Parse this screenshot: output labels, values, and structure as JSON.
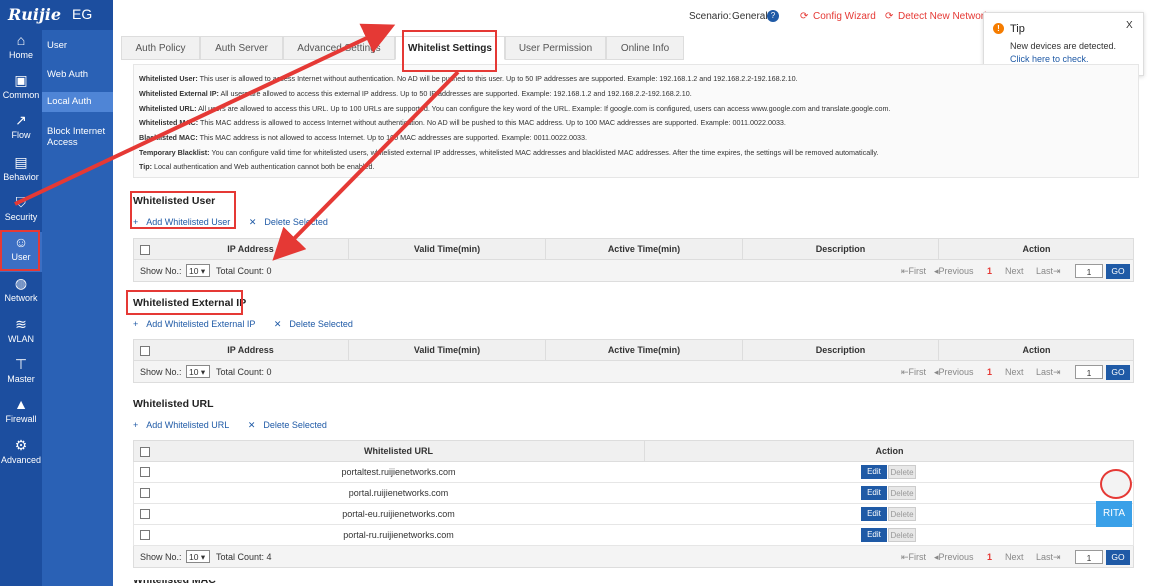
{
  "app": {
    "brand": "Ruijie",
    "product": "EG"
  },
  "nav": [
    {
      "label": "Home",
      "icon": "home-icon"
    },
    {
      "label": "Common",
      "icon": "briefcase-icon"
    },
    {
      "label": "Flow",
      "icon": "chart-line-icon"
    },
    {
      "label": "Behavior",
      "icon": "monitor-icon"
    },
    {
      "label": "Security",
      "icon": "shield-icon"
    },
    {
      "label": "User",
      "icon": "user-icon"
    },
    {
      "label": "Network",
      "icon": "globe-icon"
    },
    {
      "label": "WLAN",
      "icon": "wifi-icon"
    },
    {
      "label": "Master",
      "icon": "hierarchy-icon"
    },
    {
      "label": "Firewall",
      "icon": "firewall-icon"
    },
    {
      "label": "Advanced",
      "icon": "gear-icon"
    }
  ],
  "subnav": [
    "User",
    "Web Auth",
    "Local Auth",
    "Block Internet Access"
  ],
  "header": {
    "scenario_label": "Scenario:",
    "scenario_value": "General",
    "config_wizard": "Config Wizard",
    "detect_network": "Detect New Network"
  },
  "tip": {
    "title": "Tip",
    "message": "New devices are detected.",
    "link": "Click here to check.",
    "close": "X"
  },
  "tabs": [
    "Auth Policy",
    "Auth Server",
    "Advanced Settings",
    "Whitelist Settings",
    "User Permission",
    "Online Info"
  ],
  "info": [
    {
      "k": "Whitelisted User:",
      "v": "This user is allowed to access Internet without authentication. No AD will be pushed to this user. Up to 50 IP addresses are supported. Example: 192.168.1.2 and 192.168.2.2-192.168.2.10."
    },
    {
      "k": "Whitelisted External IP:",
      "v": "All users are allowed to access this external IP address. Up to 50 IP addresses are supported. Example: 192.168.1.2 and 192.168.2.2-192.168.2.10."
    },
    {
      "k": "Whitelisted URL:",
      "v": "All users are allowed to access this URL. Up to 100 URLs are supported. You can configure the key word of the URL. Example: If google.com is configured, users can access www.google.com and translate.google.com."
    },
    {
      "k": "Whitelisted MAC:",
      "v": "This MAC address is allowed to access Internet without authentication. No AD will be pushed to this MAC address. Up to 100 MAC addresses are supported. Example: 0011.0022.0033."
    },
    {
      "k": "Blacklisted MAC:",
      "v": "This MAC address is not allowed to access Internet. Up to 100 MAC addresses are supported. Example: 0011.0022.0033."
    },
    {
      "k": "Temporary Blacklist:",
      "v": "You can configure valid time for whitelisted users, whitelisted external IP addresses, whitelisted MAC addresses and blacklisted MAC addresses. After the time expires, the settings will be removed automatically."
    },
    {
      "k": "Tip:",
      "v": "Local authentication and Web authentication cannot both be enabled."
    }
  ],
  "sections": {
    "user": {
      "title": "Whitelisted User",
      "add": "Add Whitelisted User",
      "del": "Delete Selected",
      "total": "Total Count: 0"
    },
    "extip": {
      "title": "Whitelisted External IP",
      "add": "Add Whitelisted External IP",
      "del": "Delete Selected",
      "total": "Total Count: 0"
    },
    "url": {
      "title": "Whitelisted URL",
      "add": "Add Whitelisted URL",
      "del": "Delete Selected",
      "total": "Total Count: 4"
    }
  },
  "ip_columns": [
    "IP Address",
    "Valid Time(min)",
    "Active Time(min)",
    "Description",
    "Action"
  ],
  "url_columns": [
    "Whitelisted URL",
    "Action"
  ],
  "url_rows": [
    "portaltest.ruijienetworks.com",
    "portal.ruijienetworks.com",
    "portal-eu.ruijienetworks.com",
    "portal-ru.ruijienetworks.com"
  ],
  "row_actions": {
    "edit": "Edit",
    "delete": "Delete"
  },
  "pager": {
    "show_no": "Show No.:",
    "size": "10",
    "first": "First",
    "previous": "Previous",
    "page": "1",
    "next": "Next",
    "last": "Last",
    "input": "1",
    "go": "GO"
  },
  "bottom_title": "Whitelisted MAC",
  "mascot": "RITA",
  "colors": {
    "nav": "#1c4e9f",
    "subnav": "#2a61b5",
    "accent": "#1f5aa6",
    "highlight": "#e53935"
  }
}
